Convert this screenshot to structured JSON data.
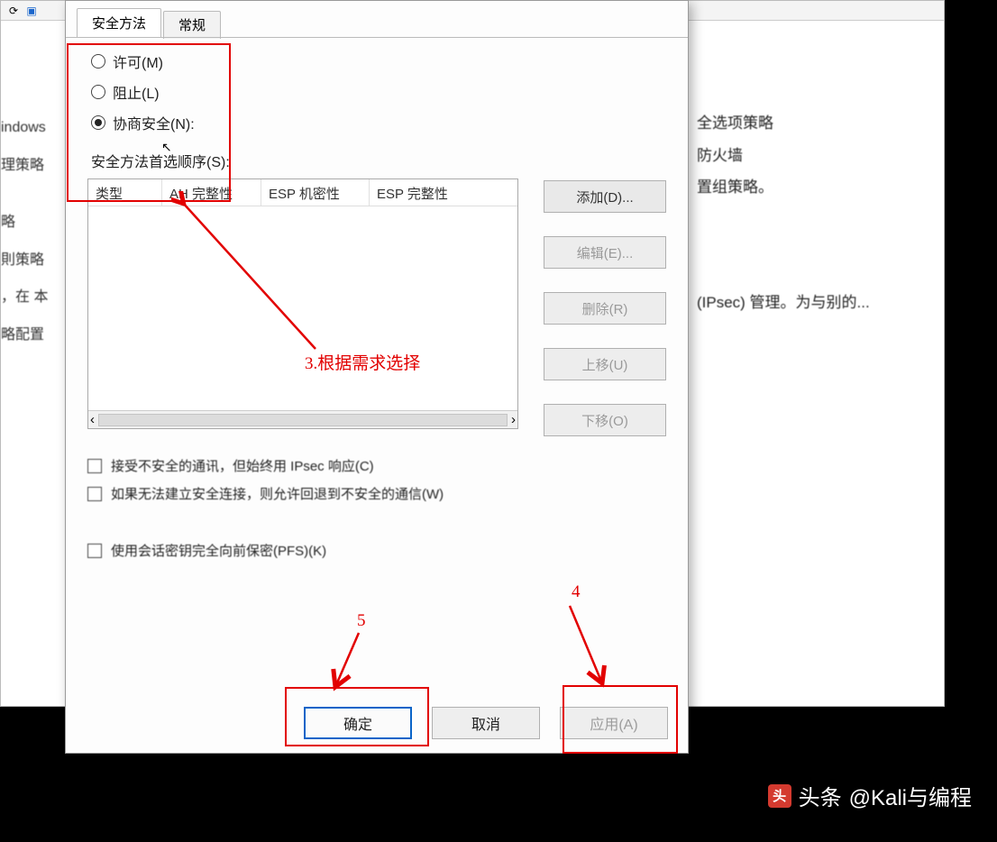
{
  "bg": {
    "left_items": [
      "indows",
      "理策略",
      "略",
      "則策略",
      "，在 本",
      "略配置"
    ],
    "right_items": [
      "全选项策略",
      "防火墙",
      "置组策略。",
      "(IPsec) 管理。为与别的..."
    ]
  },
  "dialog": {
    "tabs": {
      "active": "安全方法",
      "inactive": "常规"
    },
    "radios": {
      "permit": "许可(M)",
      "block": "阻止(L)",
      "negotiate": "协商安全(N):"
    },
    "pref_label": "安全方法首选顺序(S):",
    "columns": {
      "c1": "类型",
      "c2": "AH 完整性",
      "c3": "ESP 机密性",
      "c4": "ESP 完整性"
    },
    "side": {
      "add": "添加(D)...",
      "edit": "编辑(E)...",
      "remove": "删除(R)",
      "up": "上移(U)",
      "down": "下移(O)"
    },
    "checks": {
      "c1": "接受不安全的通讯，但始终用 IPsec 响应(C)",
      "c2": "如果无法建立安全连接，则允许回退到不安全的通信(W)",
      "c3": "使用会话密钥完全向前保密(PFS)(K)"
    },
    "buttons": {
      "ok": "确定",
      "cancel": "取消",
      "apply": "应用(A)"
    }
  },
  "annotations": {
    "step3": "3.根据需求选择",
    "step4": "4",
    "step5": "5"
  },
  "watermark": {
    "brand": "头条",
    "handle": "@Kali与编程"
  }
}
